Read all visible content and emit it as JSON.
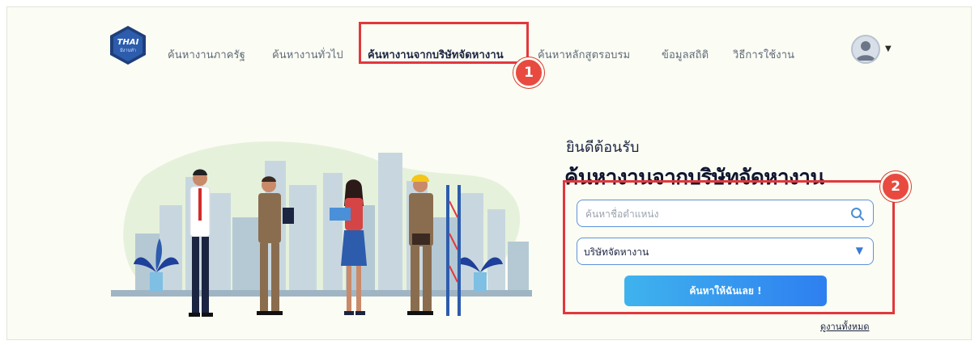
{
  "nav": {
    "logo_text": "THAI",
    "logo_sub": "มีงานทำ",
    "items": [
      {
        "label": "ค้นหางานภาครัฐ"
      },
      {
        "label": "ค้นหางานทั่วไป"
      },
      {
        "label": "ค้นหางานจากบริษัทจัดหางาน",
        "active": true
      },
      {
        "label": "ค้นหาหลักสูตรอบรม"
      },
      {
        "label": "ข้อมูลสถิติ"
      },
      {
        "label": "วิธีการใช้งาน"
      }
    ]
  },
  "hero": {
    "welcome": "ยินดีต้อนรับ",
    "headline": "ค้นหางานจากบริษัทจัดหางาน",
    "search_placeholder": "ค้นหาชื่อตำแหน่ง",
    "select_value": "บริษัทจัดหางาน",
    "submit_label": "ค้นหาให้ฉันเลย !",
    "see_all_label": "ดูงานทั้งหมด"
  },
  "annotations": {
    "badge_1": "1",
    "badge_2": "2",
    "color": "#e2383c"
  },
  "colors": {
    "background": "#fbfcf3",
    "accent": "#2e7ff0",
    "navy": "#1b2440"
  },
  "icons": [
    "search-icon",
    "chevron-down-icon",
    "user-avatar-icon"
  ]
}
